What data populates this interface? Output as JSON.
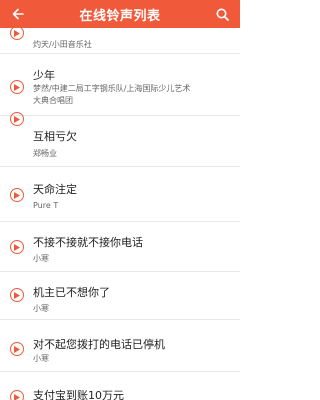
{
  "header": {
    "title": "在线铃声列表",
    "back_icon": "arrow-left-icon",
    "search_icon": "search-icon"
  },
  "accent_color": "#f05a3a",
  "songs": [
    {
      "name": "",
      "artist": "灼天/小田音乐社"
    },
    {
      "name": "少年",
      "artist": "梦然/中建二局工字钢乐队/上海国际少儿艺术大典合唱团"
    },
    {
      "name": "互相亏欠",
      "artist": "郑畅业"
    },
    {
      "name": "天命注定",
      "artist": "Pure T"
    },
    {
      "name": "不接不接就不接你电话",
      "artist": "小寒"
    },
    {
      "name": "机主已不想你了",
      "artist": "小寒"
    },
    {
      "name": "对不起您拨打的电话已停机",
      "artist": "小寒"
    },
    {
      "name": "支付宝到账10万元",
      "artist": ""
    }
  ]
}
